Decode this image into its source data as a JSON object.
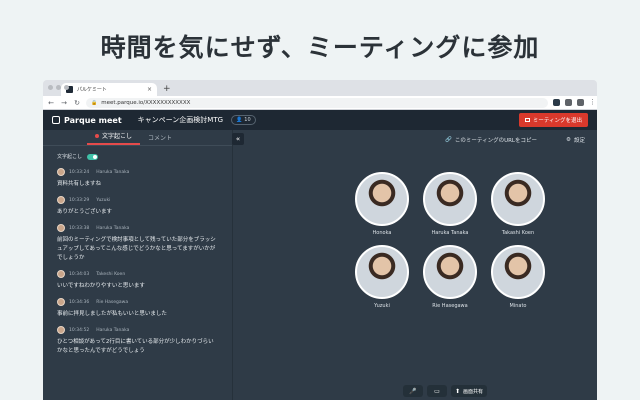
{
  "headline": "時間を気にせず、ミーティングに参加",
  "browser": {
    "tab_title": "パルケミート",
    "new_tab": "+",
    "url": "meet.parque.io/XXXXXXXXXXXX",
    "nav": {
      "back": "←",
      "forward": "→",
      "reload": "↻"
    }
  },
  "app": {
    "logo": "Parque meet",
    "meeting_title": "キャンペーン企画検討MTG",
    "participant_count": "10",
    "leave_button": "ミーティングを退出"
  },
  "sidebar": {
    "tab_transcript": "文字起こし",
    "tab_comment": "コメント",
    "collapse": "«",
    "toggle_label": "文字起こし",
    "transcript": [
      {
        "time": "10:33:24",
        "name": "Haruka Tanaka",
        "text": "資料共有しますね"
      },
      {
        "time": "10:33:29",
        "name": "Yuzuki",
        "text": "ありがとうございます"
      },
      {
        "time": "10:33:38",
        "name": "Haruka Tanaka",
        "text": "前回のミーティングで検討事項として残っていた部分をブラッシュアップしてあってこんな感じでどうかなと思ってますがいかがでしょうか"
      },
      {
        "time": "10:34:03",
        "name": "Takeshi Koen",
        "text": "いいですねわかりやすいと思います"
      },
      {
        "time": "10:34:36",
        "name": "Rie Hasegawa",
        "text": "事前に拝見しましたが私もいいと思いました"
      },
      {
        "time": "10:34:52",
        "name": "Haruka Tanaka",
        "text": "ひとつ相談があって2行目に書いている部分が少しわかりづらいかなと思ったんですがどうでしょう"
      }
    ]
  },
  "main": {
    "copy_link": "このミーティングのURLをコピー",
    "settings": "設定",
    "participants": [
      {
        "name": "Honoka"
      },
      {
        "name": "Haruka Tanaka"
      },
      {
        "name": "Takashi Koen"
      },
      {
        "name": "Yuzuki"
      },
      {
        "name": "Rie Hasegawa"
      },
      {
        "name": "Minato"
      }
    ],
    "controls": {
      "mic": "🎤",
      "camera": "▭",
      "share_icon": "⬆",
      "share_label": "画面共有"
    }
  }
}
